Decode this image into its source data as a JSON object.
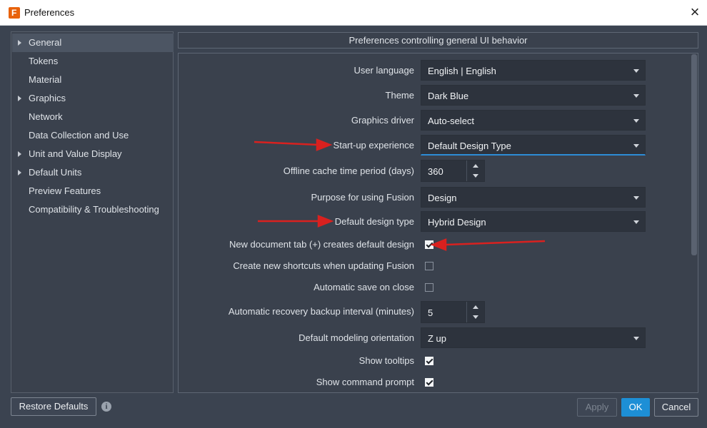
{
  "window": {
    "title": "Preferences",
    "app_icon_letter": "F"
  },
  "sidebar": {
    "items": [
      {
        "label": "General",
        "expandable": true,
        "selected": true
      },
      {
        "label": "Tokens",
        "expandable": false
      },
      {
        "label": "Material",
        "expandable": false
      },
      {
        "label": "Graphics",
        "expandable": true
      },
      {
        "label": "Network",
        "expandable": false
      },
      {
        "label": "Data Collection and Use",
        "expandable": false
      },
      {
        "label": "Unit and Value Display",
        "expandable": true
      },
      {
        "label": "Default Units",
        "expandable": true
      },
      {
        "label": "Preview Features",
        "expandable": false
      },
      {
        "label": "Compatibility & Troubleshooting",
        "expandable": false
      }
    ]
  },
  "panel": {
    "header": "Preferences controlling general UI behavior",
    "user_language": {
      "label": "User language",
      "value": "English | English"
    },
    "theme": {
      "label": "Theme",
      "value": "Dark Blue"
    },
    "graphics_driver": {
      "label": "Graphics driver",
      "value": "Auto-select"
    },
    "startup_experience": {
      "label": "Start-up experience",
      "value": "Default Design Type"
    },
    "offline_cache": {
      "label": "Offline cache time period (days)",
      "value": "360"
    },
    "purpose": {
      "label": "Purpose for using Fusion",
      "value": "Design"
    },
    "default_design_type": {
      "label": "Default design type",
      "value": "Hybrid Design"
    },
    "new_doc_tab": {
      "label": "New document tab (+) creates default design",
      "checked": true
    },
    "create_shortcuts": {
      "label": "Create new shortcuts when updating Fusion",
      "checked": false
    },
    "auto_save": {
      "label": "Automatic save on close",
      "checked": false
    },
    "recovery_interval": {
      "label": "Automatic recovery backup interval (minutes)",
      "value": "5"
    },
    "modeling_orientation": {
      "label": "Default modeling orientation",
      "value": "Z up"
    },
    "show_tooltips": {
      "label": "Show tooltips",
      "checked": true
    },
    "show_command_prompt": {
      "label": "Show command prompt",
      "checked": true
    }
  },
  "footer": {
    "restore_defaults": "Restore Defaults",
    "info_icon": "i",
    "apply": "Apply",
    "ok": "OK",
    "cancel": "Cancel"
  },
  "colors": {
    "accent": "#1d8fd6",
    "annotation_arrow": "#d9211f",
    "background": "#3b4350"
  }
}
